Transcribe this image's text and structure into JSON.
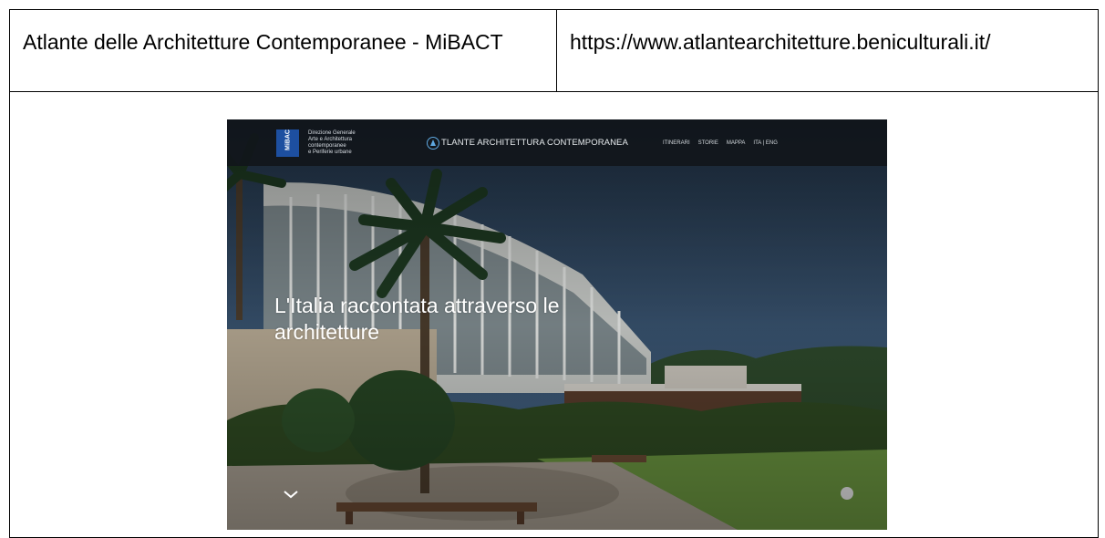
{
  "document": {
    "title_cell": "Atlante delle Architetture Contemporanee - MiBACT",
    "url_cell": "https://www.atlantearchitetture.beniculturali.it/"
  },
  "site": {
    "ministry_logo_text": "MiBAC",
    "department_lines": [
      "Direzione Generale",
      "Arte e Architettura",
      "contemporanee",
      "e Periferie urbane"
    ],
    "site_name": "TLANTE ARCHITETTURA CONTEMPORANEA",
    "nav": [
      "ITINERARI",
      "STORIE",
      "MAPPA",
      "ITA | ENG"
    ],
    "hero_title": "L'Italia raccontata attraverso le architetture",
    "icons": {
      "scroll": "chevron-down-icon",
      "site_logo": "atlante-logo-icon"
    },
    "colors": {
      "nav_bg": "#11161b",
      "sky": "#2f4d6e",
      "lawn": "#5f8a3a",
      "accent": "#5fa8e0"
    }
  }
}
